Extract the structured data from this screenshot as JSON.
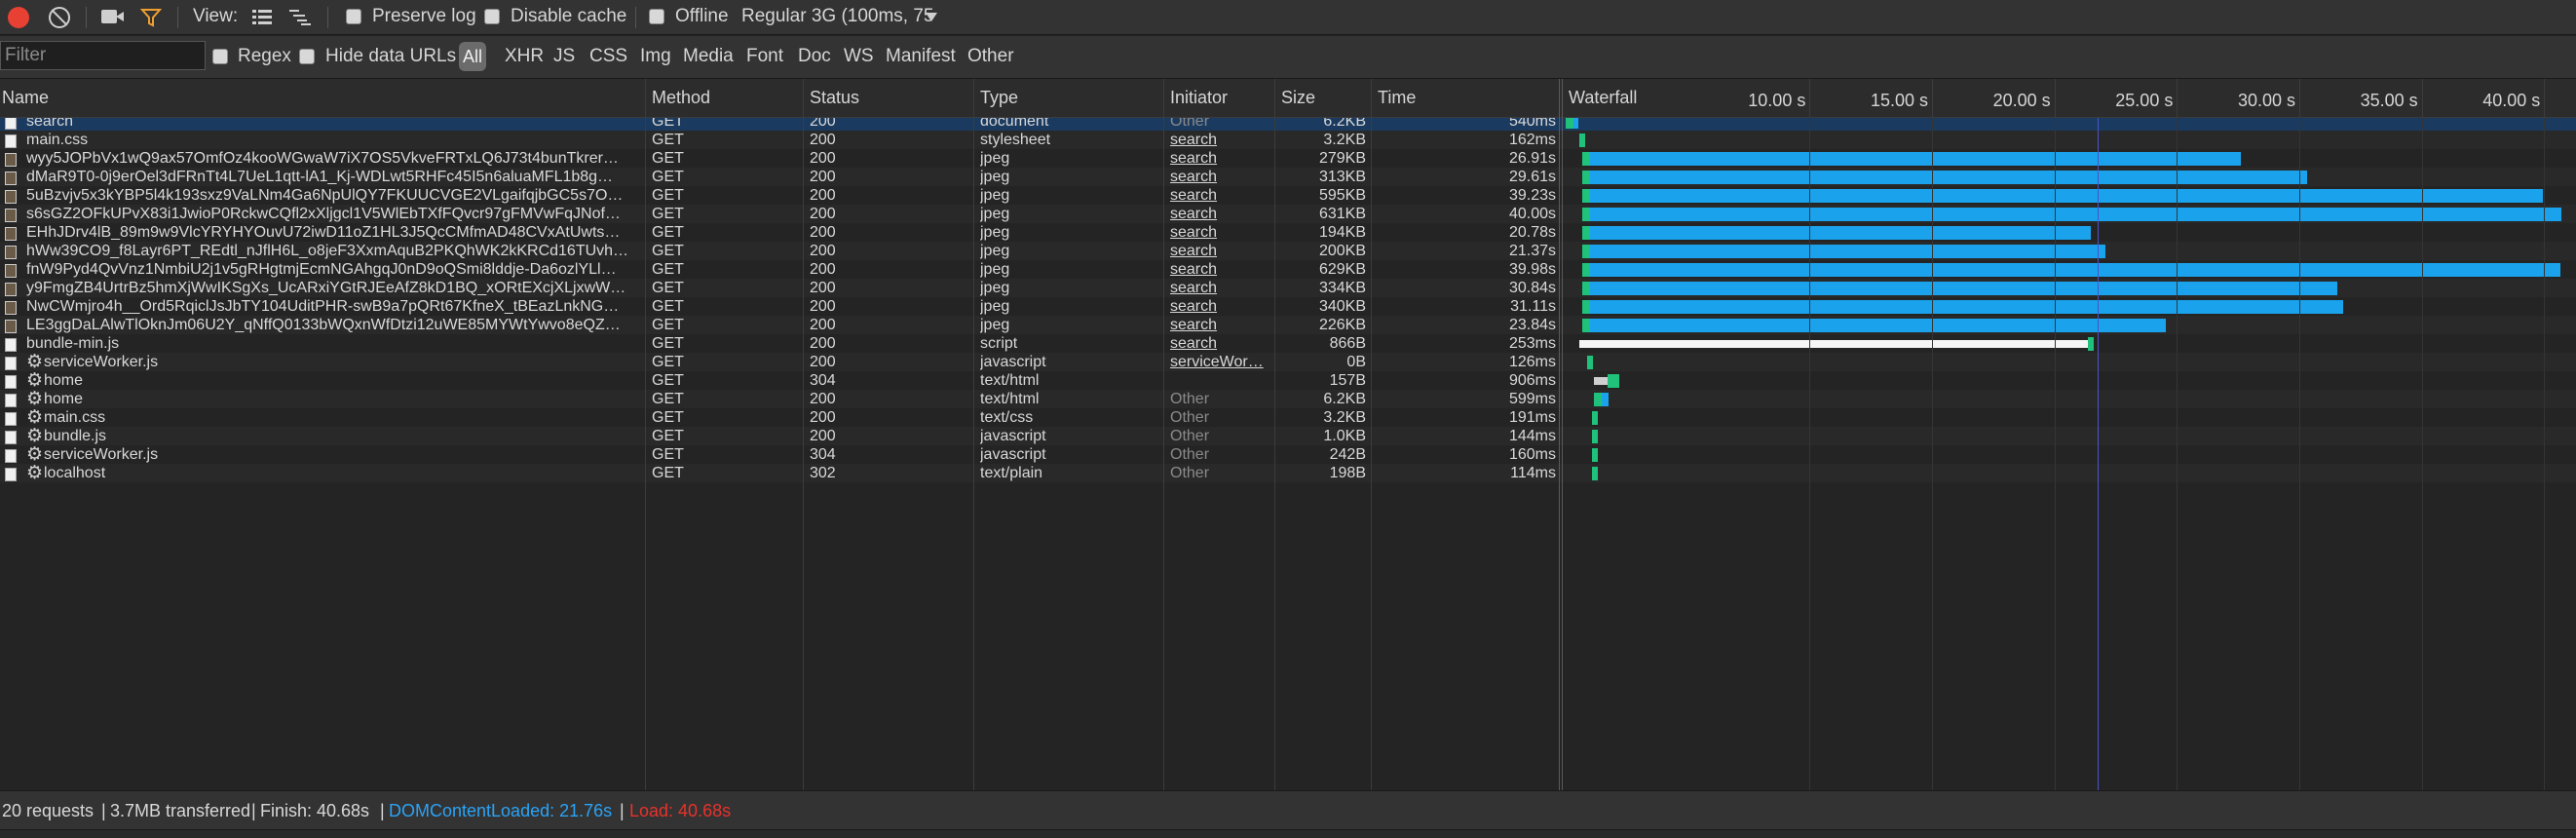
{
  "toolbar": {
    "view_label": "View:",
    "preserve_log": "Preserve log",
    "disable_cache": "Disable cache",
    "offline": "Offline",
    "throttle": "Regular 3G (100ms, 75"
  },
  "filterbar": {
    "placeholder": "Filter",
    "regex": "Regex",
    "hide_data_urls": "Hide data URLs",
    "types": [
      "All",
      "XHR",
      "JS",
      "CSS",
      "Img",
      "Media",
      "Font",
      "Doc",
      "WS",
      "Manifest",
      "Other"
    ]
  },
  "columns": {
    "name": "Name",
    "method": "Method",
    "status": "Status",
    "type": "Type",
    "initiator": "Initiator",
    "size": "Size",
    "time": "Time",
    "waterfall": "Waterfall"
  },
  "waterfall": {
    "ticks": [
      "10.00 s",
      "15.00 s",
      "20.00 s",
      "25.00 s",
      "30.00 s",
      "35.00 s",
      "40.00 s"
    ],
    "axis_max_s": 41.3,
    "domcontentloaded_s": 21.76
  },
  "requests": [
    {
      "name": "search",
      "method": "GET",
      "status": "200",
      "type": "document",
      "initiator": "Other",
      "size": "6.2KB",
      "time": "540ms",
      "icon": "document-icon",
      "gear": false,
      "start_s": 0.02,
      "duration_s": 0.54
    },
    {
      "name": "main.css",
      "method": "GET",
      "status": "200",
      "type": "stylesheet",
      "initiator": "search",
      "size": "3.2KB",
      "time": "162ms",
      "icon": "document-icon",
      "gear": false,
      "start_s": 0.6,
      "duration_s": 0.16
    },
    {
      "name": "wyy5JOPbVx1wQ9ax57OmfOz4kooWGwaW7iX7OS5VkveFRTxLQ6J73t4bunTkrer…",
      "method": "GET",
      "status": "200",
      "type": "jpeg",
      "initiator": "search",
      "size": "279KB",
      "time": "26.91s",
      "icon": "image-icon",
      "gear": false,
      "start_s": 0.7,
      "duration_s": 26.91
    },
    {
      "name": "dMaR9T0-0j9erOel3dFRnTt4L7UeL1qtt-lA1_Kj-WDLwt5RHFc45I5n6aluaMFL1b8g…",
      "method": "GET",
      "status": "200",
      "type": "jpeg",
      "initiator": "search",
      "size": "313KB",
      "time": "29.61s",
      "icon": "image-icon",
      "gear": false,
      "start_s": 0.7,
      "duration_s": 29.61
    },
    {
      "name": "5uBzvjv5x3kYBP5l4k193sxz9VaLNm4Ga6NpUlQY7FKUUCVGE2VLgaifqjbGC5s7O…",
      "method": "GET",
      "status": "200",
      "type": "jpeg",
      "initiator": "search",
      "size": "595KB",
      "time": "39.23s",
      "icon": "image-icon",
      "gear": false,
      "start_s": 0.7,
      "duration_s": 39.23
    },
    {
      "name": "s6sGZ2OFkUPvX83i1JwioP0RckwCQfl2xXljgcl1V5WlEbTXfFQvcr97gFMVwFqJNof…",
      "method": "GET",
      "status": "200",
      "type": "jpeg",
      "initiator": "search",
      "size": "631KB",
      "time": "40.00s",
      "icon": "image-icon",
      "gear": false,
      "start_s": 0.7,
      "duration_s": 40.0
    },
    {
      "name": "EHhJDrv4lB_89m9w9VlcYRYHYOuvU72iwD11oZ1HL3J5QcCMfmAD48CVxAtUwts…",
      "method": "GET",
      "status": "200",
      "type": "jpeg",
      "initiator": "search",
      "size": "194KB",
      "time": "20.78s",
      "icon": "image-icon",
      "gear": false,
      "start_s": 0.7,
      "duration_s": 20.78
    },
    {
      "name": "hWw39CO9_f8Layr6PT_REdtl_nJflH6L_o8jeF3XxmAquB2PKQhWK2kKRCd16TUvh…",
      "method": "GET",
      "status": "200",
      "type": "jpeg",
      "initiator": "search",
      "size": "200KB",
      "time": "21.37s",
      "icon": "image-icon",
      "gear": false,
      "start_s": 0.7,
      "duration_s": 21.37
    },
    {
      "name": "fnW9Pyd4QvVnz1NmbiU2j1v5gRHgtmjEcmNGAhgqJ0nD9oQSmi8lddje-Da6ozlYLl…",
      "method": "GET",
      "status": "200",
      "type": "jpeg",
      "initiator": "search",
      "size": "629KB",
      "time": "39.98s",
      "icon": "image-icon",
      "gear": false,
      "start_s": 0.7,
      "duration_s": 39.98
    },
    {
      "name": "y9FmgZB4UrtrBz5hmXjWwIKSgXs_UcARxiYGtRJEeAfZ8kD1BQ_xORtEXcjXLjxwW…",
      "method": "GET",
      "status": "200",
      "type": "jpeg",
      "initiator": "search",
      "size": "334KB",
      "time": "30.84s",
      "icon": "image-icon",
      "gear": false,
      "start_s": 0.7,
      "duration_s": 30.84
    },
    {
      "name": "NwCWmjro4h__Ord5RqiclJsJbTY104UditPHR-swB9a7pQRt67KfneX_tBEazLnkNG…",
      "method": "GET",
      "status": "200",
      "type": "jpeg",
      "initiator": "search",
      "size": "340KB",
      "time": "31.11s",
      "icon": "image-icon",
      "gear": false,
      "start_s": 0.7,
      "duration_s": 31.11
    },
    {
      "name": "LE3ggDaLAlwTlOknJm06U2Y_qNffQ0133bWQxnWfDtzi12uWE85MYWtYwvo8eQZ…",
      "method": "GET",
      "status": "200",
      "type": "jpeg",
      "initiator": "search",
      "size": "226KB",
      "time": "23.84s",
      "icon": "image-icon",
      "gear": false,
      "start_s": 0.7,
      "duration_s": 23.84
    },
    {
      "name": "bundle-min.js",
      "method": "GET",
      "status": "200",
      "type": "script",
      "initiator": "search",
      "size": "866B",
      "time": "253ms",
      "icon": "document-icon",
      "gear": false,
      "start_s": 0.6,
      "duration_s": 21.0,
      "mostly_waiting": true
    },
    {
      "name": "serviceWorker.js",
      "method": "GET",
      "status": "200",
      "type": "javascript",
      "initiator": "serviceWor…",
      "size": "0B",
      "time": "126ms",
      "icon": "document-icon",
      "gear": true,
      "start_s": 0.9,
      "duration_s": 0.13
    },
    {
      "name": "home",
      "method": "GET",
      "status": "304",
      "type": "text/html",
      "initiator": "",
      "size": "157B",
      "time": "906ms",
      "icon": "document-icon",
      "gear": true,
      "start_s": 1.2,
      "duration_s": 0.91,
      "ttfb_only": true
    },
    {
      "name": "home",
      "method": "GET",
      "status": "200",
      "type": "text/html",
      "initiator": "Other",
      "size": "6.2KB",
      "time": "599ms",
      "icon": "document-icon",
      "gear": true,
      "start_s": 1.2,
      "duration_s": 0.6
    },
    {
      "name": "main.css",
      "method": "GET",
      "status": "200",
      "type": "text/css",
      "initiator": "Other",
      "size": "3.2KB",
      "time": "191ms",
      "icon": "document-icon",
      "gear": true,
      "start_s": 1.1,
      "duration_s": 0.19
    },
    {
      "name": "bundle.js",
      "method": "GET",
      "status": "200",
      "type": "javascript",
      "initiator": "Other",
      "size": "1.0KB",
      "time": "144ms",
      "icon": "document-icon",
      "gear": true,
      "start_s": 1.1,
      "duration_s": 0.14
    },
    {
      "name": "serviceWorker.js",
      "method": "GET",
      "status": "304",
      "type": "javascript",
      "initiator": "Other",
      "size": "242B",
      "time": "160ms",
      "icon": "document-icon",
      "gear": true,
      "start_s": 1.1,
      "duration_s": 0.16
    },
    {
      "name": "localhost",
      "method": "GET",
      "status": "302",
      "type": "text/plain",
      "initiator": "Other",
      "size": "198B",
      "time": "114ms",
      "icon": "document-icon",
      "gear": true,
      "start_s": 1.1,
      "duration_s": 0.11
    }
  ],
  "summary": {
    "requests": "20 requests",
    "transferred": "3.7MB transferred",
    "finish": "Finish: 40.68s",
    "dom_content_loaded": "DOMContentLoaded: 21.76s",
    "load": "Load: 40.68s",
    "separator": "|"
  },
  "colors": {
    "receiving": "#1aa3ec",
    "ttfb": "#1fc17b",
    "waiting": "#cfcfcf",
    "domcontentloaded": "#2ba3f5",
    "load": "#e8322b",
    "selected_row": "#1b3a5f"
  }
}
